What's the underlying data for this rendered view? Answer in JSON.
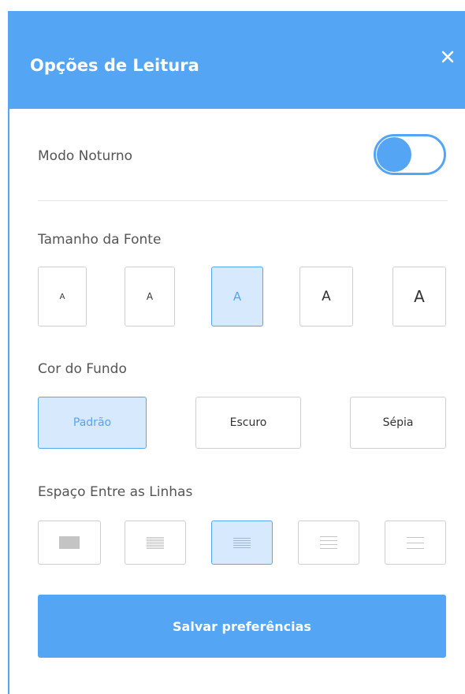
{
  "header": {
    "title": "Opções de Leitura",
    "close_icon": "close-icon"
  },
  "night_mode": {
    "label": "Modo Noturno",
    "enabled": true
  },
  "font_size": {
    "label": "Tamanho da Fonte",
    "options": [
      {
        "label": "A",
        "selected": false
      },
      {
        "label": "A",
        "selected": false
      },
      {
        "label": "A",
        "selected": true
      },
      {
        "label": "A",
        "selected": false
      },
      {
        "label": "A",
        "selected": false
      }
    ]
  },
  "background_color": {
    "label": "Cor do Fundo",
    "options": [
      {
        "label": "Padrão",
        "selected": true
      },
      {
        "label": "Escuro",
        "selected": false
      },
      {
        "label": "Sépia",
        "selected": false
      }
    ]
  },
  "line_spacing": {
    "label": "Espaço Entre as Linhas",
    "options": [
      {
        "icon": "spacing-solid-icon",
        "selected": false
      },
      {
        "icon": "spacing-tight-icon",
        "selected": false
      },
      {
        "icon": "spacing-normal-icon",
        "selected": true
      },
      {
        "icon": "spacing-wide-icon",
        "selected": false
      },
      {
        "icon": "spacing-widest-icon",
        "selected": false
      }
    ]
  },
  "save_button": {
    "label": "Salvar preferências"
  },
  "colors": {
    "accent": "#55a5f5",
    "selected_bg": "#d6e9fd",
    "border": "#cfcfcf"
  }
}
